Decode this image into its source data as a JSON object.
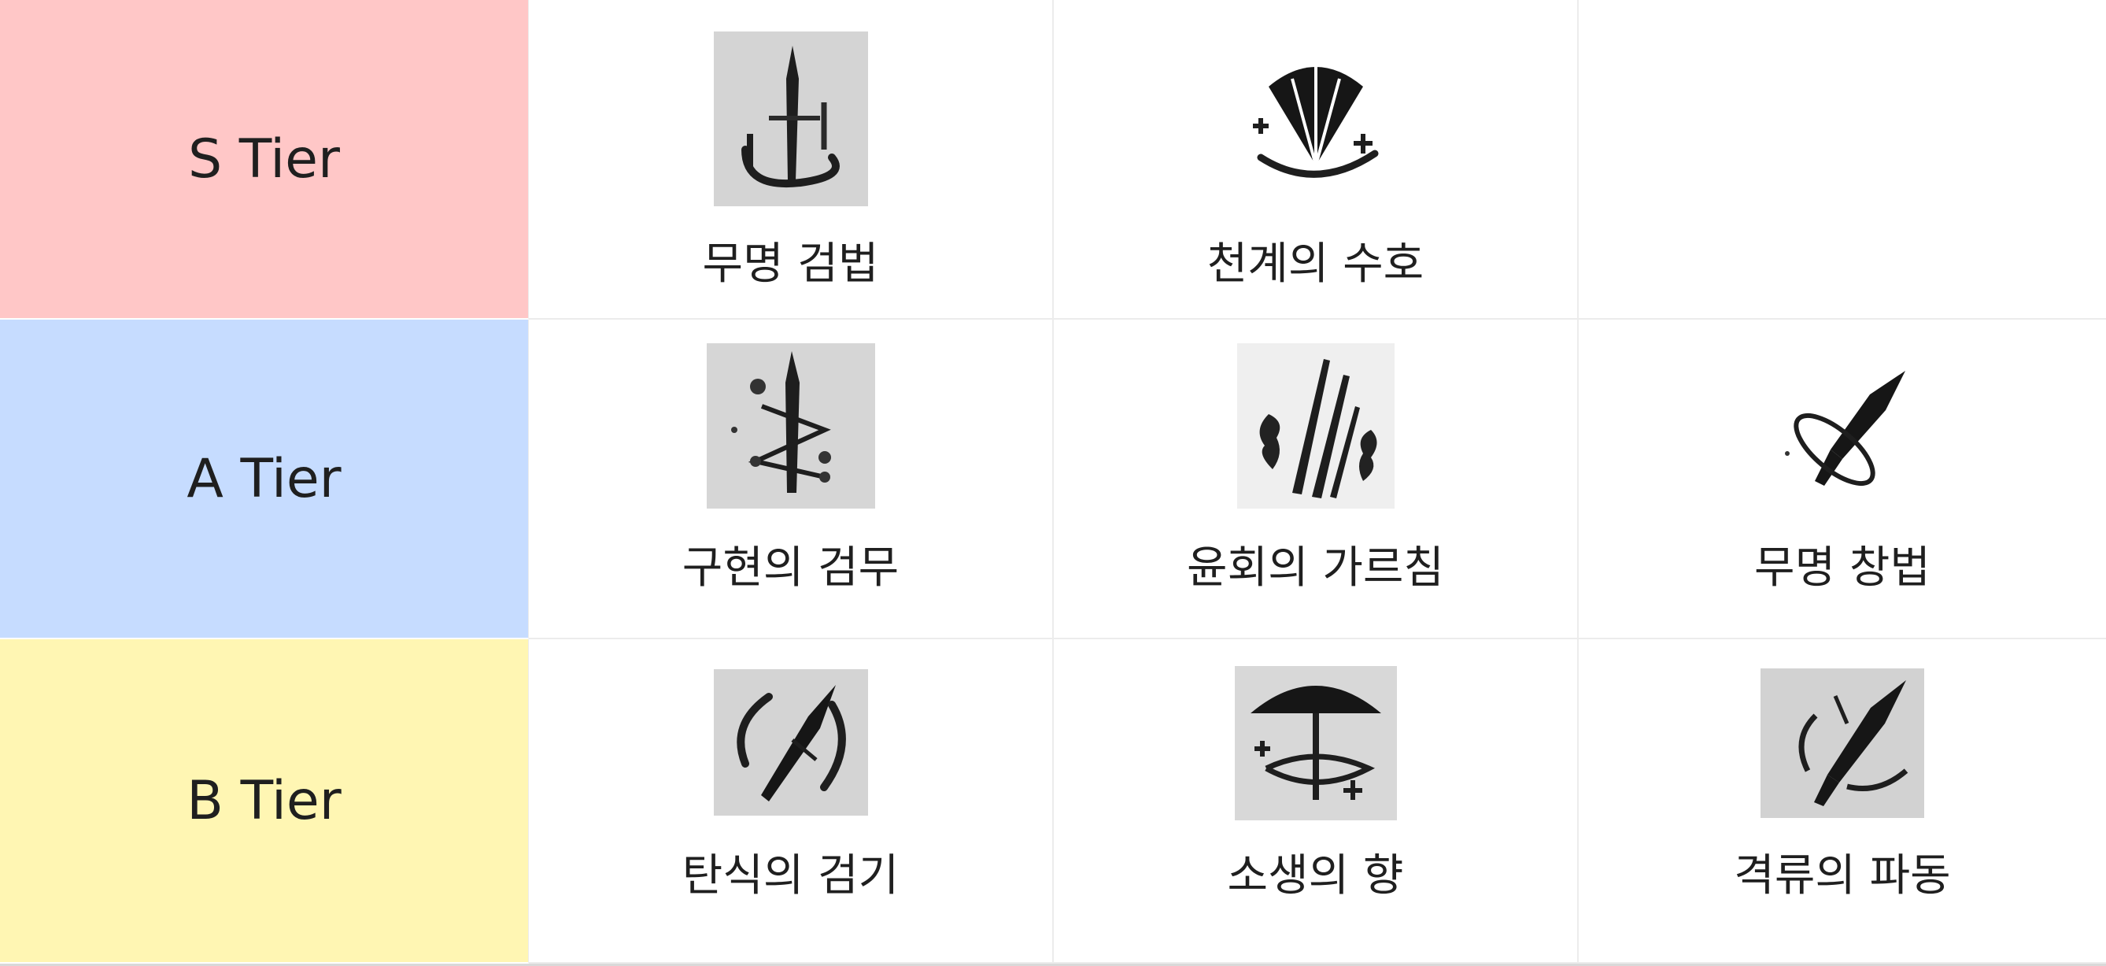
{
  "tiers": [
    {
      "label": "S Tier",
      "color": "#ffc7c7",
      "skills": [
        {
          "name": "무명 검법",
          "icon": "sword-circle-icon"
        },
        {
          "name": "천계의 수호",
          "icon": "fan-icon"
        }
      ]
    },
    {
      "label": "A Tier",
      "color": "#c6dcff",
      "skills": [
        {
          "name": "구현의 검무",
          "icon": "sword-orbs-icon"
        },
        {
          "name": "윤회의 가르침",
          "icon": "flame-slashes-icon"
        },
        {
          "name": "무명 창법",
          "icon": "spear-icon"
        }
      ]
    },
    {
      "label": "B Tier",
      "color": "#fff6b3",
      "skills": [
        {
          "name": "탄식의 검기",
          "icon": "sword-swirl-icon"
        },
        {
          "name": "소생의 향",
          "icon": "umbrella-icon"
        },
        {
          "name": "격류의 파동",
          "icon": "spear-burst-icon"
        }
      ]
    }
  ]
}
